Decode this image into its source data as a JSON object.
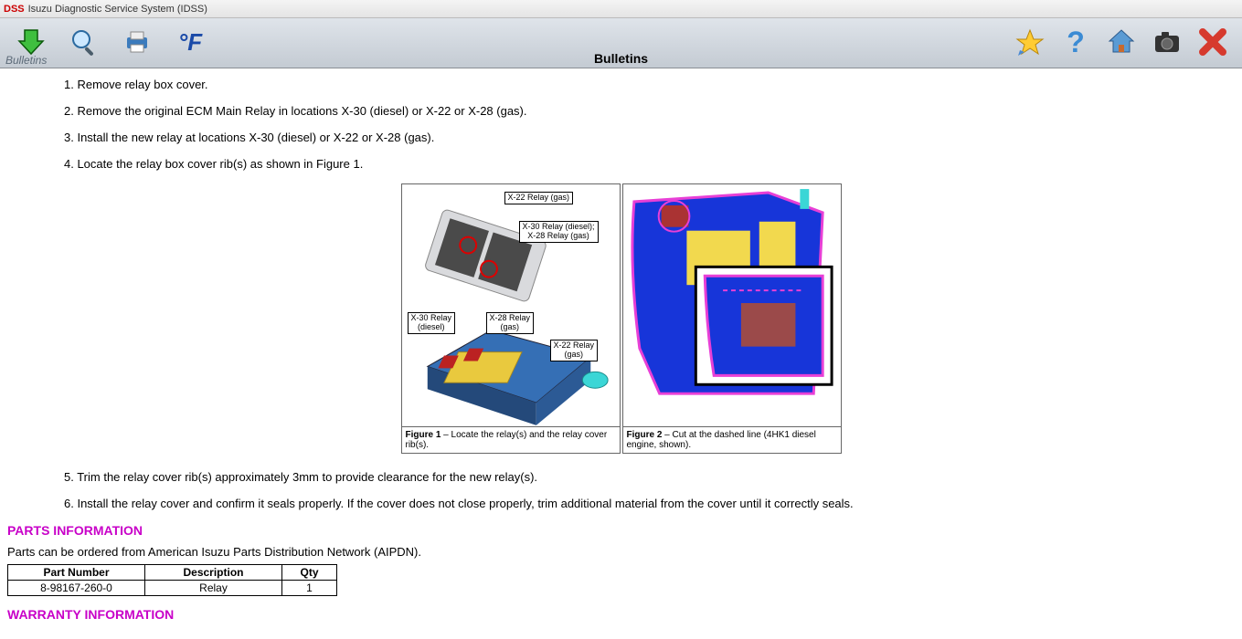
{
  "window": {
    "prefix": "DSS",
    "title": "Isuzu Diagnostic Service System (IDSS)"
  },
  "toolbar": {
    "tab_label": "Bulletins",
    "section_title": "Bulletins",
    "temp_unit": "°F"
  },
  "steps_top": [
    "1. Remove relay box cover.",
    "2. Remove the original ECM Main Relay in locations X-30 (diesel) or X-22 or X-28 (gas).",
    "3. Install the new relay at locations X-30 (diesel) or X-22 or X-28 (gas).",
    "4. Locate the relay box cover rib(s) as shown in Figure 1."
  ],
  "figure1": {
    "callouts": {
      "x22_relay_gas": "X-22 Relay (gas)",
      "x30_relay_diesel_x28_gas_top": "X-30 Relay (diesel);\nX-28 Relay (gas)",
      "x30_relay_diesel": "X-30 Relay\n(diesel)",
      "x28_relay_gas": "X-28 Relay\n(gas)",
      "x22_relay_gas_bottom": "X-22 Relay\n(gas)"
    },
    "caption_strong": "Figure 1",
    "caption_rest": " – Locate the relay(s) and the relay cover rib(s)."
  },
  "figure2": {
    "caption_strong": "Figure 2",
    "caption_rest": " – Cut at the dashed line (4HK1 diesel engine, shown)."
  },
  "steps_bottom": [
    "5. Trim the relay cover rib(s) approximately 3mm to provide clearance for the new relay(s).",
    "6. Install the relay cover and confirm it seals properly. If the cover does not close properly, trim additional material from the cover until it correctly seals."
  ],
  "parts_info": {
    "heading": "PARTS INFORMATION",
    "note": "Parts can be ordered from American Isuzu Parts Distribution Network (AIPDN).",
    "headers": {
      "pn": "Part Number",
      "desc": "Description",
      "qty": "Qty"
    },
    "rows": [
      {
        "pn": "8-98167-260-0",
        "desc": "Relay",
        "qty": "1"
      }
    ]
  },
  "warranty_heading": "WARRANTY INFORMATION"
}
